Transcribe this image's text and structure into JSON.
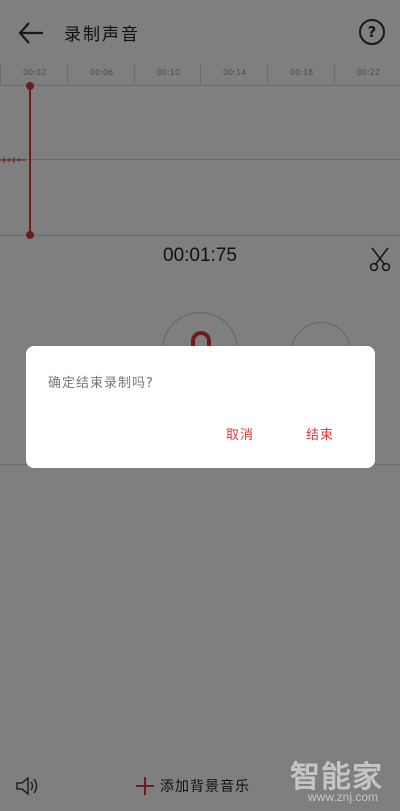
{
  "header": {
    "title": "录制声音",
    "help_glyph": "?",
    "icons": {
      "back": "arrow-left-icon",
      "help": "question-circle-icon"
    }
  },
  "timeline": {
    "ticks": [
      "00:02",
      "00:06",
      "00:10",
      "00:14",
      "00:18",
      "00:22"
    ]
  },
  "recorder": {
    "elapsed": "00:01:75",
    "icons": {
      "cut": "scissors-icon",
      "record": "microphone-record-icon"
    }
  },
  "bottom_bar": {
    "add_music_label": "添加背景音乐",
    "icons": {
      "volume": "speaker-icon",
      "add": "plus-icon"
    }
  },
  "dialog": {
    "message": "确定结束录制吗?",
    "cancel_label": "取消",
    "confirm_label": "结束"
  },
  "watermark": {
    "brand": "智能家",
    "url": "www.znj.com"
  },
  "colors": {
    "accent": "#d63a3a",
    "overlay": "rgba(0,0,0,0.5)"
  }
}
